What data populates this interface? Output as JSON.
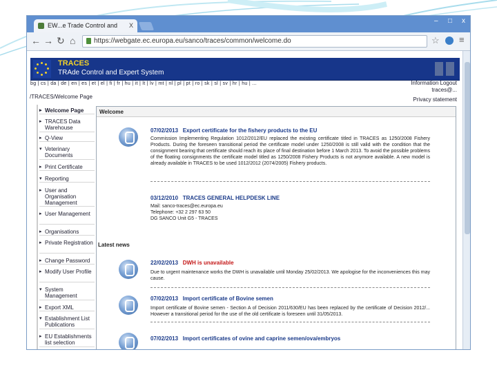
{
  "browser": {
    "tab_title": "EW...e Trade Control and",
    "tab_close": "X",
    "url": "https://webgate.ec.europa.eu/sanco/traces/common/welcome.do",
    "window_controls": [
      "–",
      "□",
      "x"
    ]
  },
  "banner": {
    "title": "TRACES",
    "subtitle": "TRAde Control and Expert System"
  },
  "langbar": "bg | cs | da | de | en | es | et | el | fi | fr | hu | it | lt | lv | mt | nl | pl | pt | ro | sk | sl | sv | hr | hu | ...",
  "right_links": [
    "Information",
    "Logout",
    "traces@..."
  ],
  "breadcrumb": "/TRACES/Welcome Page",
  "privacy_link": "Privacy statement",
  "sidebar": [
    {
      "label": "Welcome Page",
      "active": true
    },
    {
      "label": "TRACES Data Warehouse"
    },
    {
      "label": "Q-View"
    },
    {
      "label": "Veterinary Documents",
      "expandable": true
    },
    {
      "label": "Print Certificate"
    },
    {
      "label": "Reporting",
      "expandable": true
    },
    {
      "label": "User and Organisation Management"
    },
    {
      "label": "User Management"
    },
    {
      "label": "Organisations"
    },
    {
      "label": "Private Registration"
    },
    {
      "label": "Change Password"
    },
    {
      "label": "Modify User Profile"
    },
    {
      "label": "System Management",
      "expandable": true
    },
    {
      "label": "Export XML"
    },
    {
      "label": "Establishment List Publications",
      "expandable": true
    },
    {
      "label": "EU Establishments list selection"
    }
  ],
  "welcome": {
    "heading": "Welcome",
    "items": [
      {
        "date": "07/02/2013",
        "title": "Export certificate for the fishery products to the EU",
        "body": "Commission Implementing Regulation 1012/2012/EU replaced the existing certificate titled in TRACES as 1250/2008 Fishery Products. During the foreseen transitional period the certificate model under 1250/2008 is still valid with the condition that the consignment bearing that certificate should reach its place of final destination before 1 March 2013. To avoid the possible problems of the floating consignments the certificate model titled as 1250/2008 Fishery Products is not anymore available. A new model is already available in TRACES to be used 1012/2012 (2074/2005) Fishery products."
      },
      {
        "date": "03/12/2010",
        "title": "TRACES GENERAL HELPDESK LINE",
        "body": "Mail: sanco-traces@ec.europa.eu\nTelephone: +32 2 297 63 50\nDG SANCO Unit G5 - TRACES"
      }
    ]
  },
  "latest_news": {
    "heading": "Latest news",
    "items": [
      {
        "date": "22/02/2013",
        "title": "DWH is unavailable",
        "title_red": true,
        "body": "Due to urgent maintenance works the DWH is unavailable until Monday 25/02/2013. We apologise for the inconveniences this may cause."
      },
      {
        "date": "07/02/2013",
        "title": "Import certificate of Bovine semen",
        "body": "Import certificate of Bovine semen - Section A of Decision 2011/630/EU has been replaced by the certificate of Decision 2012/... However a transitional period for the use of the old certificate is foreseen until 31/05/2013."
      },
      {
        "date": "07/02/2013",
        "title": "Import certificates of ovine and caprine semen/ova/embryos",
        "body": ""
      }
    ]
  }
}
